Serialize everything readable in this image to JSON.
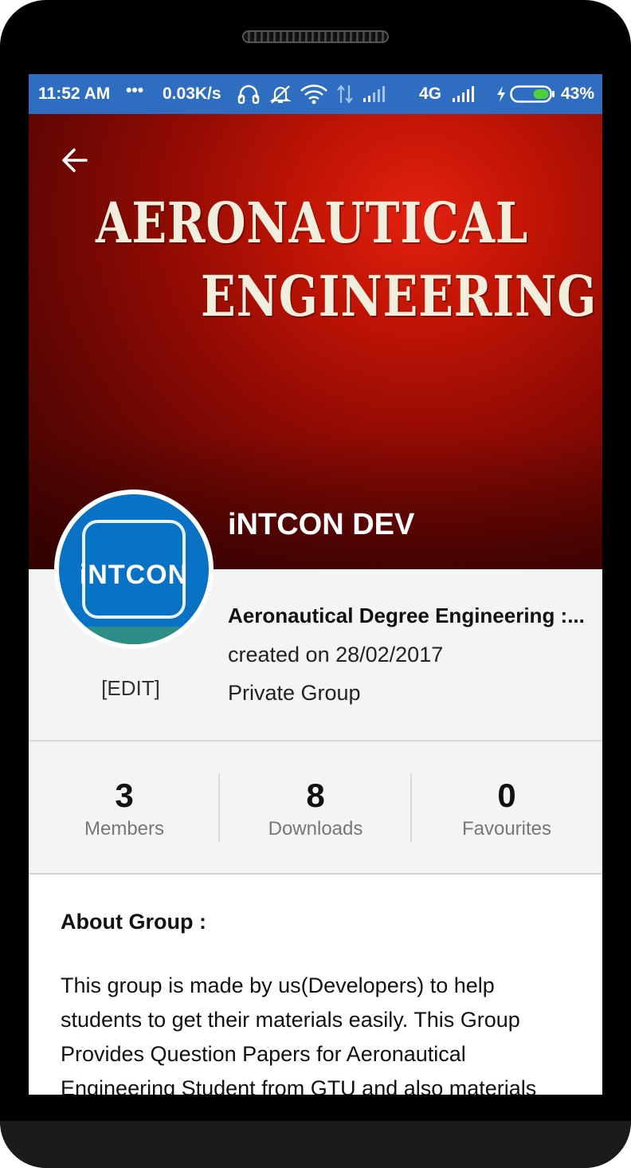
{
  "status_bar": {
    "time": "11:52 AM",
    "more": "•••",
    "speed": "0.03K/s",
    "network": "4G",
    "battery": "43%",
    "icons": [
      "headset-icon",
      "alarm-off-icon",
      "wifi-icon",
      "data-arrows-icon",
      "signal-icon",
      "signal-icon",
      "charging-icon",
      "battery-icon"
    ],
    "color": "#2f6dc0",
    "battery_level": 0.43
  },
  "cover": {
    "line1": "AERONAUTICAL",
    "line2": "ENGINEERING",
    "color": "#c31505"
  },
  "group": {
    "name": "iNTCON DEV",
    "avatar_text": "iNTCON",
    "edit_label": "[EDIT]",
    "subtitle": "Aeronautical Degree Engineering :...",
    "created": "created on 28/02/2017",
    "privacy": "Private Group"
  },
  "stats": [
    {
      "value": "3",
      "label": "Members"
    },
    {
      "value": "8",
      "label": "Downloads"
    },
    {
      "value": "0",
      "label": "Favourites"
    }
  ],
  "about": {
    "title": "About Group :",
    "text": "This group is made by us(Developers) to help students to get their materials easily. This Group Provides Question Papers for Aeronautical Engineering Student from GTU and also materials"
  }
}
